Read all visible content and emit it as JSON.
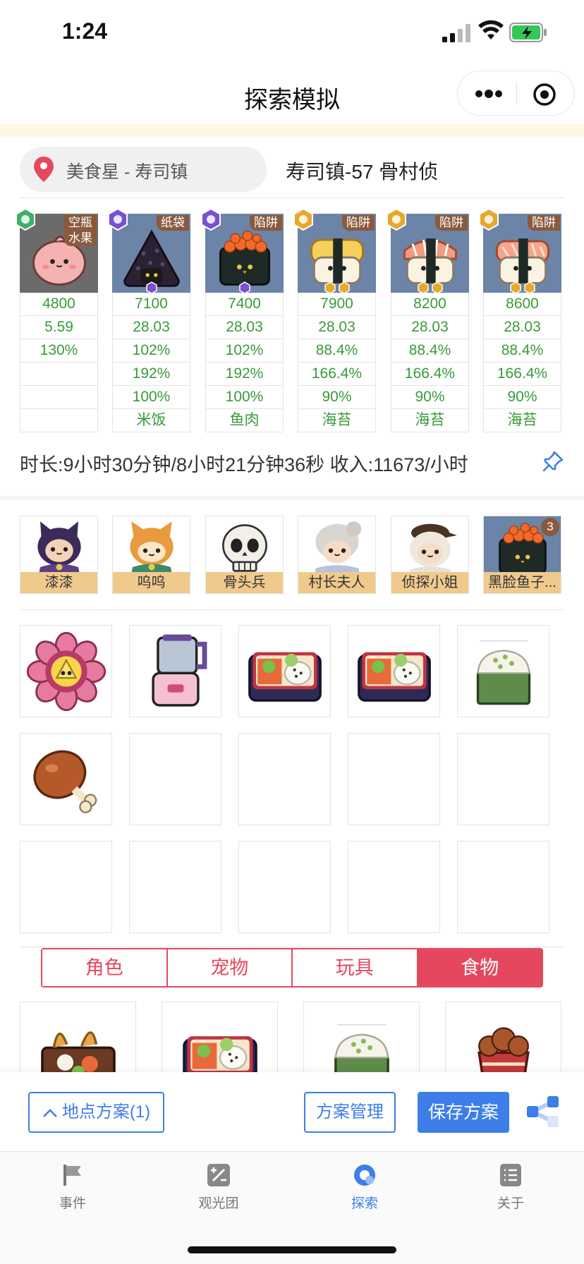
{
  "status_bar": {
    "time": "1:24"
  },
  "nav": {
    "title": "探索模拟"
  },
  "location": {
    "place": "美食星 - 寿司镇",
    "scheme_name": "寿司镇-57 骨村侦"
  },
  "stat_cards": [
    {
      "tag": "空瓶\n水果",
      "badge_color": "#3fae6a",
      "sprite": "peach-blob",
      "values": [
        "4800",
        "5.59",
        "130%",
        "",
        "",
        ""
      ]
    },
    {
      "tag": "纸袋",
      "badge_color": "#7a4fd1",
      "sprite": "black-onigiri",
      "values": [
        "7100",
        "28.03",
        "102%",
        "192%",
        "100%",
        "米饭"
      ]
    },
    {
      "tag": "陷阱",
      "badge_color": "#7a4fd1",
      "sprite": "salmon-roe-gunkan",
      "values": [
        "7400",
        "28.03",
        "102%",
        "192%",
        "100%",
        "鱼肉"
      ]
    },
    {
      "tag": "陷阱",
      "badge_color": "#e7a82b",
      "sprite": "tamago-sushi",
      "values": [
        "7900",
        "28.03",
        "88.4%",
        "166.4%",
        "90%",
        "海苔"
      ]
    },
    {
      "tag": "陷阱",
      "badge_color": "#e7a82b",
      "sprite": "shrimp-sushi",
      "values": [
        "8200",
        "28.03",
        "88.4%",
        "166.4%",
        "90%",
        "海苔"
      ]
    },
    {
      "tag": "陷阱",
      "badge_color": "#e7a82b",
      "sprite": "salmon-sushi",
      "values": [
        "8600",
        "28.03",
        "88.4%",
        "166.4%",
        "90%",
        "海苔"
      ]
    }
  ],
  "summary": {
    "text": "时长:9小时30分钟/8小时21分钟36秒 收入:11673/小时"
  },
  "team": [
    {
      "name": "漆漆"
    },
    {
      "name": "呜呜"
    },
    {
      "name": "骨头兵"
    },
    {
      "name": "村长夫人"
    },
    {
      "name": "侦探小姐"
    },
    {
      "name": "黑脸鱼子...",
      "count": "3"
    }
  ],
  "items": [
    "flower-badge",
    "blender",
    "bento-box",
    "bento-box",
    "rice-block",
    "drumstick",
    "",
    "",
    "",
    "",
    "",
    "",
    "",
    "",
    ""
  ],
  "category_tabs": [
    "角色",
    "宠物",
    "玩具",
    "食物"
  ],
  "active_tab": "食物",
  "picker": [
    "tempura-bento",
    "bento-box",
    "rice-block",
    "fried-chicken-bucket"
  ],
  "action_bar": {
    "location_plans": "地点方案(1)",
    "manage": "方案管理",
    "save": "保存方案"
  },
  "tabbar": [
    {
      "label": "事件",
      "icon": "flag-icon"
    },
    {
      "label": "观光团",
      "icon": "ratio-icon"
    },
    {
      "label": "探索",
      "icon": "explore-icon"
    },
    {
      "label": "关于",
      "icon": "list-icon"
    }
  ],
  "colors": {
    "accent_blue": "#3e7ee8",
    "accent_red": "#e5485e",
    "stat_green": "#3a9a3a"
  }
}
